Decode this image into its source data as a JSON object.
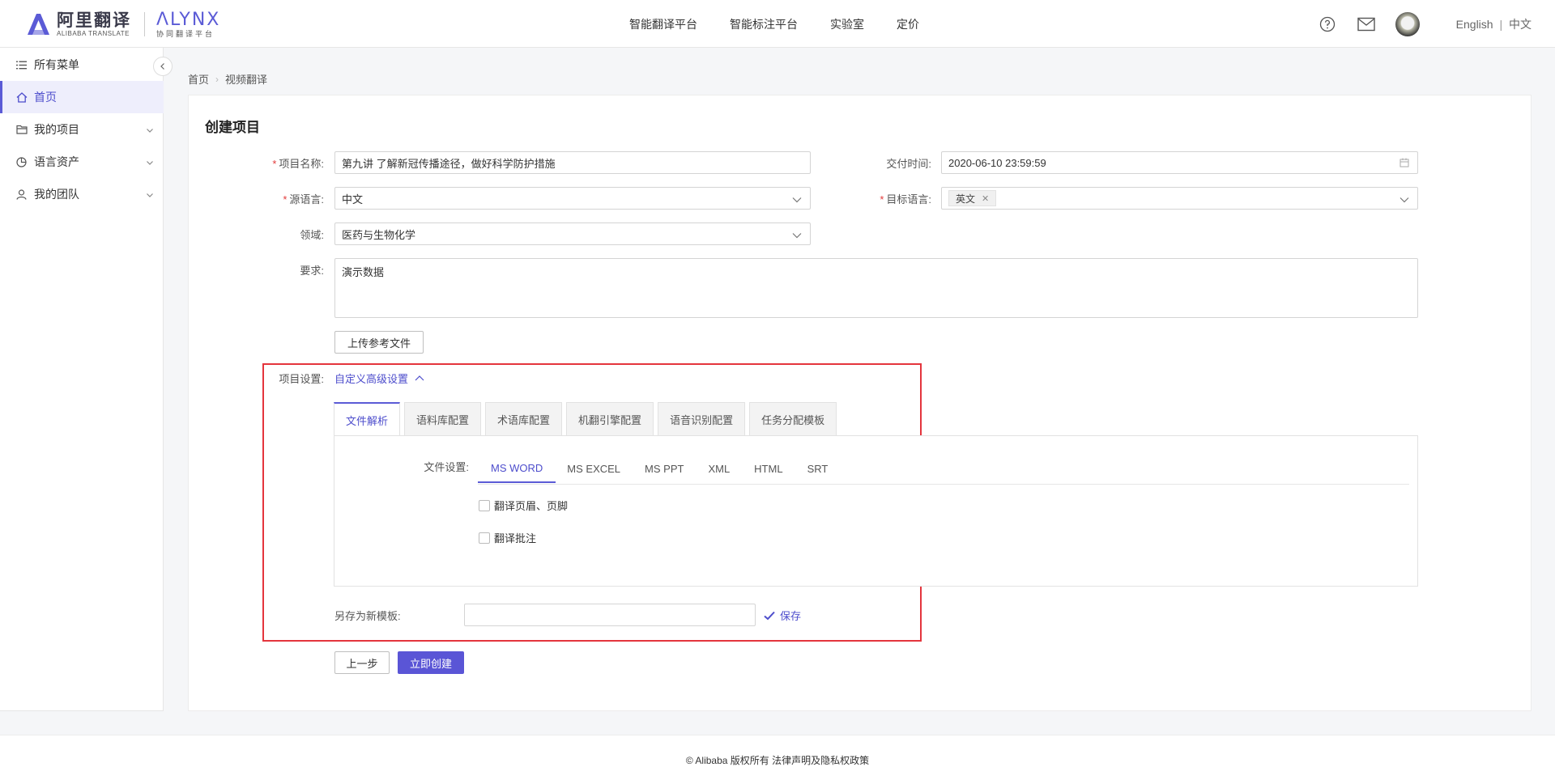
{
  "header": {
    "logo_cn": "阿里翻译",
    "logo_cn_sub": "ALIBABA TRANSLATE",
    "logo_en": "ΛLYNX",
    "logo_en_sub": "协同翻译平台",
    "nav": [
      "智能翻译平台",
      "智能标注平台",
      "实验室",
      "定价"
    ],
    "lang_en": "English",
    "lang_sep": "|",
    "lang_cn": "中文",
    "icons": [
      "help-icon",
      "mail-icon",
      "avatar"
    ]
  },
  "sidebar": {
    "items": [
      {
        "label": "所有菜单",
        "icon": "list-icon"
      },
      {
        "label": "首页",
        "icon": "home-icon"
      },
      {
        "label": "我的项目",
        "icon": "folder-icon"
      },
      {
        "label": "语言资产",
        "icon": "pie-icon"
      },
      {
        "label": "我的团队",
        "icon": "user-icon"
      }
    ]
  },
  "breadcrumb": {
    "home": "首页",
    "current": "视频翻译"
  },
  "form": {
    "title": "创建项目",
    "name_label": "项目名称:",
    "name_value": "第九讲 了解新冠传播途径，做好科学防护措施",
    "deadline_label": "交付时间:",
    "deadline_value": "2020-06-10 23:59:59",
    "source_label": "源语言:",
    "source_value": "中文",
    "target_label": "目标语言:",
    "target_tag": "英文",
    "domain_label": "领域:",
    "domain_value": "医药与生物化学",
    "req_label": "要求:",
    "req_value": "演示数据",
    "upload_btn": "上传参考文件",
    "settings_label": "项目设置:",
    "settings_link": "自定义高级设置",
    "tabs": [
      "文件解析",
      "语料库配置",
      "术语库配置",
      "机翻引擎配置",
      "语音识别配置",
      "任务分配模板"
    ],
    "file_settings_label": "文件设置:",
    "subtabs": [
      "MS WORD",
      "MS EXCEL",
      "MS PPT",
      "XML",
      "HTML",
      "SRT"
    ],
    "checkbox_header_footer": "翻译页眉、页脚",
    "checkbox_comments": "翻译批注",
    "save_template_label": "另存为新模板:",
    "save_link": "保存",
    "prev_btn": "上一步",
    "create_btn": "立即创建"
  },
  "footer": {
    "text": "© Alibaba 版权所有 法律声明及隐私权政策"
  },
  "colors": {
    "accent": "#5b5bd6",
    "highlight": "#e4353d",
    "required": "#e23b3b"
  }
}
